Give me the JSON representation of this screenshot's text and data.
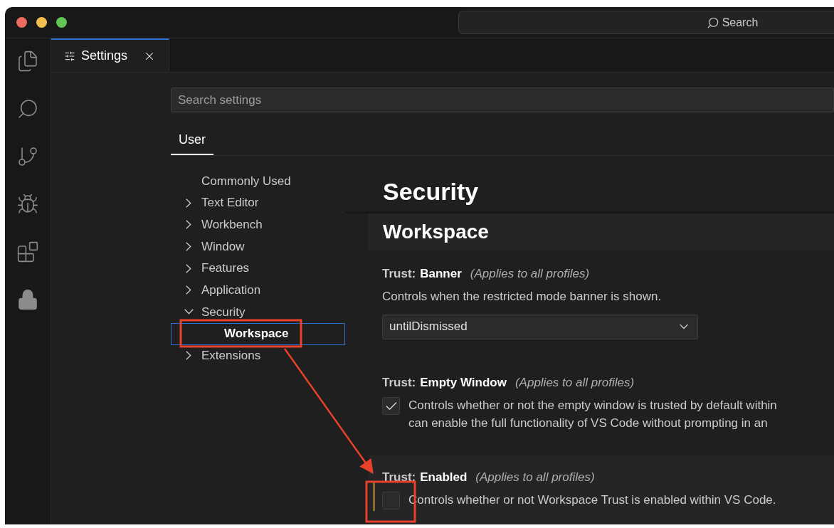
{
  "title_bar": {
    "search_label": "Search"
  },
  "tabs": [
    {
      "label": "Settings",
      "selected": true
    }
  ],
  "settings_search": {
    "placeholder": "Search settings"
  },
  "scope_tabs": [
    {
      "label": "User",
      "selected": true
    }
  ],
  "toc": [
    {
      "label": "Commonly Used",
      "kind": "leaf",
      "selected": false
    },
    {
      "label": "Text Editor",
      "kind": "group",
      "expanded": false,
      "selected": false
    },
    {
      "label": "Workbench",
      "kind": "group",
      "expanded": false,
      "selected": false
    },
    {
      "label": "Window",
      "kind": "group",
      "expanded": false,
      "selected": false
    },
    {
      "label": "Features",
      "kind": "group",
      "expanded": false,
      "selected": false
    },
    {
      "label": "Application",
      "kind": "group",
      "expanded": false,
      "selected": false
    },
    {
      "label": "Security",
      "kind": "group",
      "expanded": true,
      "selected": false,
      "children": [
        {
          "label": "Workspace",
          "selected": true
        }
      ]
    },
    {
      "label": "Extensions",
      "kind": "group",
      "expanded": false,
      "selected": false
    }
  ],
  "content": {
    "category": "Security",
    "section": "Workspace",
    "settings": [
      {
        "kind": "dropdown",
        "prefix": "Trust:",
        "name": "Banner",
        "scope": "(Applies to all profiles)",
        "description_lines": [
          "Controls when the restricted mode banner is shown."
        ],
        "value": "untilDismissed",
        "focused": false
      },
      {
        "kind": "checkbox",
        "prefix": "Trust:",
        "name": "Empty Window",
        "scope": "(Applies to all profiles)",
        "description_lines": [
          "Controls whether or not the empty window is trusted by default within",
          "can enable the full functionality of VS Code without prompting in an"
        ],
        "checked": true,
        "focused": false
      },
      {
        "kind": "checkbox",
        "prefix": "Trust:",
        "name": "Enabled",
        "scope": "(Applies to all profiles)",
        "description_lines": [
          "Controls whether or not Workspace Trust is enabled within VS Code."
        ],
        "checked": false,
        "focused": true
      }
    ]
  }
}
